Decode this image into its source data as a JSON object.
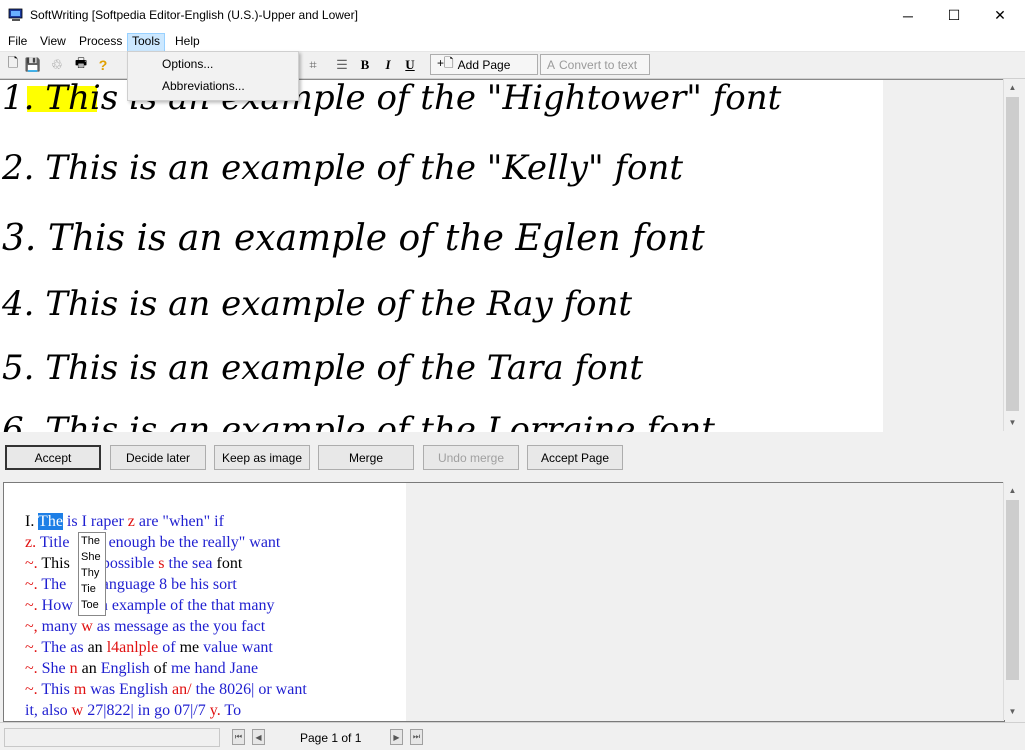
{
  "window": {
    "title": "SoftWriting [Softpedia Editor-English (U.S.)-Upper and Lower]",
    "minimize": "─",
    "maximize": "☐",
    "close": "✕"
  },
  "menubar": [
    {
      "label": "File"
    },
    {
      "label": "View"
    },
    {
      "label": "Process"
    },
    {
      "label": "Tools"
    },
    {
      "label": "Help"
    }
  ],
  "tools_menu": {
    "items": [
      {
        "label": "Options..."
      },
      {
        "label": "Abbreviations..."
      }
    ]
  },
  "toolbar": {
    "new_icon": "🗋",
    "save_icon": "💾",
    "recycle_icon": "♲",
    "print_icon": "🖶",
    "help_icon": "?",
    "crop_icon": "⌗",
    "list_icon": "☰",
    "bold": "B",
    "italic": "I",
    "underline": "U",
    "add_page": "Add Page",
    "add_page_icon": "+🗋",
    "convert_to_text": "Convert to text",
    "convert_icon": "A"
  },
  "handwriting": {
    "lines": [
      {
        "num": "1.",
        "text": "This is an example of the \"Hightower\" font",
        "highlight": "This"
      },
      {
        "num": "2.",
        "text": "This is an example of the \"Kelly\" font"
      },
      {
        "num": "3.",
        "text": "This is an example of the Eglen font"
      },
      {
        "num": "4.",
        "text": "This is an example of the Ray font"
      },
      {
        "num": "5.",
        "text": "This is an example of the Tara font"
      },
      {
        "num": "6.",
        "text": "This is an example of the Lorraine font"
      }
    ]
  },
  "actions": [
    {
      "label": "Accept"
    },
    {
      "label": "Decide later"
    },
    {
      "label": "Keep as image"
    },
    {
      "label": "Merge"
    },
    {
      "label": "Undo merge"
    },
    {
      "label": "Accept Page"
    }
  ],
  "recognized": {
    "lines": [
      [
        {
          "t": "I. ",
          "c": "k"
        },
        {
          "t": "The",
          "c": "hl"
        },
        {
          "t": " is I raper ",
          "c": "b"
        },
        {
          "t": "z",
          "c": "r"
        },
        {
          "t": " are \"when\" if",
          "c": "b"
        }
      ],
      [
        {
          "t": "z.",
          "c": "r"
        },
        {
          "t": " Title ",
          "c": "b"
        },
        {
          "t": "    an enough be the really\" want",
          "c": "b"
        }
      ],
      [
        {
          "t": "~.",
          "c": "r"
        },
        {
          "t": " This ",
          "c": "k"
        },
        {
          "t": "    n possible ",
          "c": "b"
        },
        {
          "t": "s",
          "c": "r"
        },
        {
          "t": " the sea ",
          "c": "b"
        },
        {
          "t": "font",
          "c": "k"
        }
      ],
      [
        {
          "t": "~.",
          "c": "r"
        },
        {
          "t": " The ",
          "c": "b"
        },
        {
          "t": "    a language 8 be his sort",
          "c": "b"
        }
      ],
      [
        {
          "t": "~.",
          "c": "r"
        },
        {
          "t": " How ",
          "c": "b"
        },
        {
          "t": "    an example of the that many",
          "c": "b"
        }
      ],
      [
        {
          "t": "~,",
          "c": "r"
        },
        {
          "t": " many ",
          "c": "b"
        },
        {
          "t": "w",
          "c": "r"
        },
        {
          "t": " as message as the you fact",
          "c": "b"
        }
      ],
      [
        {
          "t": "~.",
          "c": "r"
        },
        {
          "t": " The as ",
          "c": "b"
        },
        {
          "t": "an ",
          "c": "k"
        },
        {
          "t": "l4anlple",
          "c": "r"
        },
        {
          "t": " of ",
          "c": "b"
        },
        {
          "t": "me ",
          "c": "k"
        },
        {
          "t": "value want",
          "c": "b"
        }
      ],
      [
        {
          "t": "~.",
          "c": "r"
        },
        {
          "t": " She ",
          "c": "b"
        },
        {
          "t": "n",
          "c": "r"
        },
        {
          "t": " an ",
          "c": "k"
        },
        {
          "t": "English ",
          "c": "b"
        },
        {
          "t": "of ",
          "c": "k"
        },
        {
          "t": "me hand Jane",
          "c": "b"
        }
      ],
      [
        {
          "t": "~.",
          "c": "r"
        },
        {
          "t": " This ",
          "c": "b"
        },
        {
          "t": "m",
          "c": "r"
        },
        {
          "t": " was English ",
          "c": "b"
        },
        {
          "t": "an/",
          "c": "r"
        },
        {
          "t": " the 8026| or want",
          "c": "b"
        }
      ],
      [
        {
          "t": "it, also ",
          "c": "b"
        },
        {
          "t": "w",
          "c": "r"
        },
        {
          "t": " 27|822| in go 07|/7 ",
          "c": "b"
        },
        {
          "t": "y.",
          "c": "r"
        },
        {
          "t": " To",
          "c": "b"
        }
      ]
    ]
  },
  "suggestions": [
    "The",
    "She",
    "Thy",
    "Tie",
    "Toe"
  ],
  "status": {
    "page": "Page 1 of 1",
    "first": "⏮",
    "prev": "◀",
    "next": "▶",
    "last": "⏭"
  },
  "colors": {
    "blue": "#1f1fd0",
    "red": "#e01010",
    "highlight": "#1e7fe6"
  }
}
